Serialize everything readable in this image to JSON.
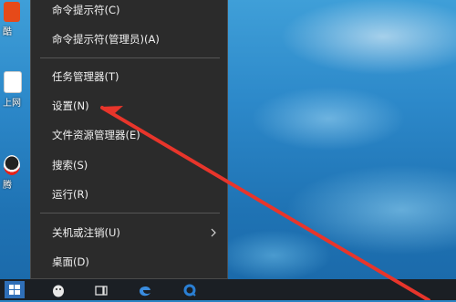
{
  "desktop": {
    "icons": [
      {
        "label": "酷",
        "name": "desktop-icon-ku"
      },
      {
        "label": "上网",
        "name": "desktop-icon-shangwang"
      },
      {
        "label": "腾",
        "name": "desktop-icon-teng"
      }
    ]
  },
  "context_menu": {
    "items": [
      {
        "label": "命令提示符(C)"
      },
      {
        "label": "命令提示符(管理员)(A)"
      },
      {
        "label": "任务管理器(T)"
      },
      {
        "label": "设置(N)"
      },
      {
        "label": "文件资源管理器(E)"
      },
      {
        "label": "搜索(S)"
      },
      {
        "label": "运行(R)"
      },
      {
        "label": "关机或注销(U)",
        "submenu_icon": "chevron-right-icon"
      },
      {
        "label": "桌面(D)"
      }
    ]
  },
  "annotation": {
    "type": "red-arrow",
    "color": "#e8352b",
    "points_to": "设置(N)"
  },
  "taskbar": {
    "icons": [
      "windows-start-icon",
      "qq-icon",
      "task-view-icon",
      "edge-icon",
      "qq-browser-icon"
    ]
  },
  "colors": {
    "menu_bg": "#2b2b2b",
    "menu_text": "#f2f2f2",
    "taskbar_bg": "#1b1f24",
    "accent": "#e8352b"
  }
}
